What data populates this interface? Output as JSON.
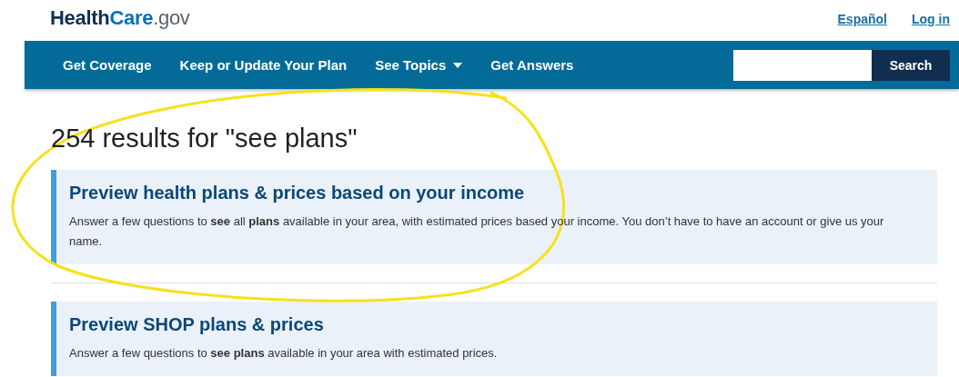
{
  "logo": {
    "parts": [
      "Health",
      "Care",
      ".gov"
    ]
  },
  "header_links": [
    {
      "label": "Español"
    },
    {
      "label": "Log in"
    }
  ],
  "nav": {
    "items": [
      {
        "label": "Get Coverage",
        "dropdown": false
      },
      {
        "label": "Keep or Update Your Plan",
        "dropdown": false
      },
      {
        "label": "See Topics",
        "dropdown": true
      },
      {
        "label": "Get Answers",
        "dropdown": false
      }
    ],
    "search_button": "Search"
  },
  "results_heading": "254 results for \"see plans\"",
  "results": [
    {
      "title": "Preview health plans & prices based on your income",
      "description": "Answer a few questions to **see** all **plans** available in your area, with estimated prices based your income. You don’t have to have an account or give us your name."
    },
    {
      "title": "Preview SHOP plans & prices",
      "description": "Answer a few questions to **see plans** available in your area with estimated prices."
    }
  ]
}
